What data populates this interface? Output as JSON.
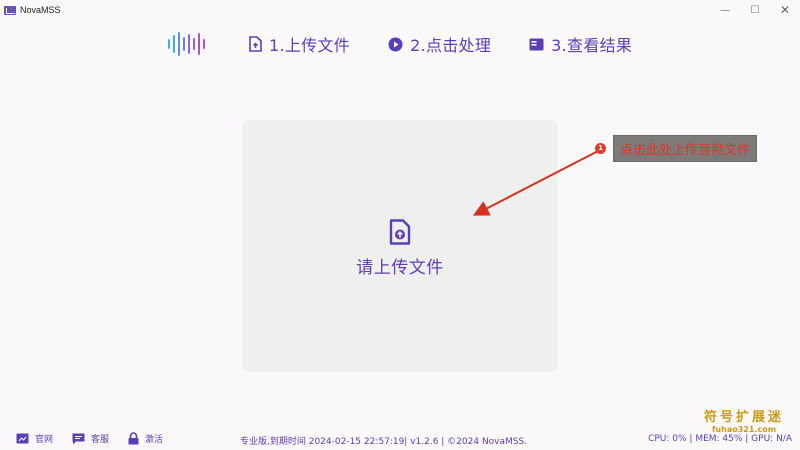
{
  "window": {
    "title": "NovaMSS",
    "controls": {
      "minimize": "—",
      "maximize": "☐",
      "close": "✕"
    }
  },
  "nav": {
    "logo_icon": "waveform-icon",
    "steps": [
      {
        "label": "1.上传文件",
        "icon": "upload-file-icon"
      },
      {
        "label": "2.点击处理",
        "icon": "play-circle-icon"
      },
      {
        "label": "3.查看结果",
        "icon": "result-card-icon"
      }
    ]
  },
  "upload": {
    "label": "请上传文件",
    "icon": "file-upload-icon"
  },
  "annotation": {
    "number": "1",
    "text": "点击此处上传音频文件"
  },
  "footer": {
    "links": [
      {
        "label": "官网",
        "icon": "website-icon"
      },
      {
        "label": "客服",
        "icon": "chat-icon"
      },
      {
        "label": "激活",
        "icon": "lock-icon"
      }
    ],
    "version_text": "专业版,到期时间 2024-02-15 22:57:19| v1.2.6 | ©2024 NovaMSS.",
    "stats_text": "CPU: 0% | MEM: 45% | GPU: N/A"
  },
  "watermark": {
    "main": "符号扩展迷",
    "sub": "fuhao321.com"
  },
  "colors": {
    "accent": "#5b3fb5",
    "annotation_red": "#e23b2b",
    "upload_bg": "#efefef",
    "page_bg": "#fbf9fc"
  }
}
